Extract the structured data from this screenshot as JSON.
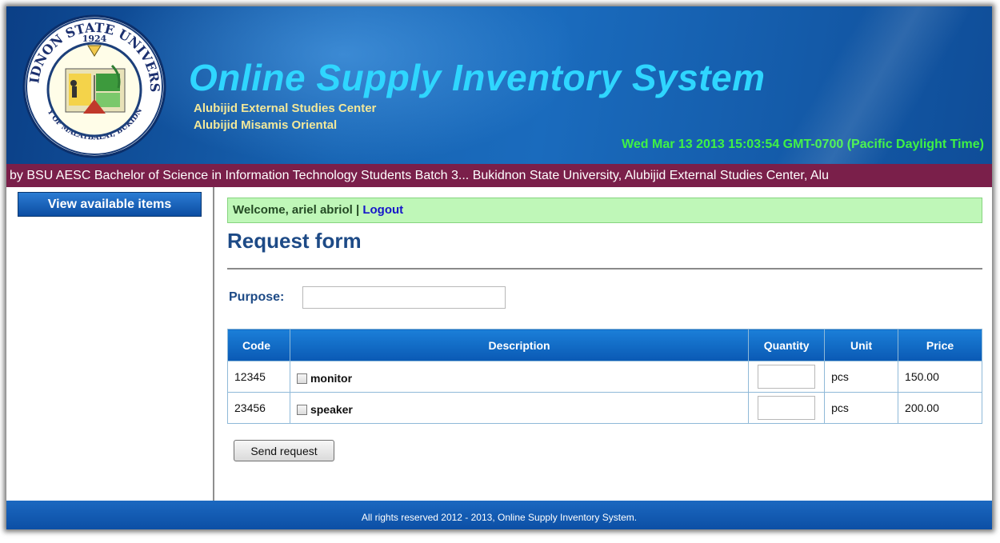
{
  "header": {
    "app_title": "Online Supply Inventory System",
    "subtitle_1": "Alubijid External Studies Center",
    "subtitle_2": "Alubijid Misamis Oriental",
    "datetime": "Wed Mar 13 2013 15:03:54 GMT-0700 (Pacific Daylight Time)",
    "seal": {
      "top_text": "BUKIDNON STATE UNIVERSITY",
      "bottom_text": "CITY OF MALAYBALAY, BUKIDNON",
      "year": "1924"
    }
  },
  "marquee": {
    "text": "l by BSU AESC Bachelor of Science in Information Technology Students Batch 3... Bukidnon State University, Alubijid External Studies Center, Alu"
  },
  "sidebar": {
    "items": [
      {
        "label": "View available items"
      }
    ]
  },
  "main": {
    "welcome_text": "Welcome, ariel abriol",
    "separator": " | ",
    "logout_label": "Logout",
    "page_title": "Request form",
    "purpose_label": "Purpose:",
    "purpose_value": "",
    "table": {
      "headers": [
        "Code",
        "Description",
        "Quantity",
        "Unit",
        "Price"
      ],
      "rows": [
        {
          "code": "12345",
          "description": "monitor",
          "checked": false,
          "quantity": "",
          "unit": "pcs",
          "price": "150.00"
        },
        {
          "code": "23456",
          "description": "speaker",
          "checked": false,
          "quantity": "",
          "unit": "pcs",
          "price": "200.00"
        }
      ]
    },
    "send_button_label": "Send request"
  },
  "footer": {
    "text": "All rights reserved 2012 - 2013, Online Supply Inventory System."
  },
  "colors": {
    "header_blue": "#1764b3",
    "title_cyan": "#2fd6ff",
    "subtitle_yellow": "#f2e89a",
    "datetime_green": "#3ff244",
    "marquee_maroon": "#7a1f4a",
    "welcome_green": "#bff7b8",
    "heading_navy": "#1d4a86"
  }
}
